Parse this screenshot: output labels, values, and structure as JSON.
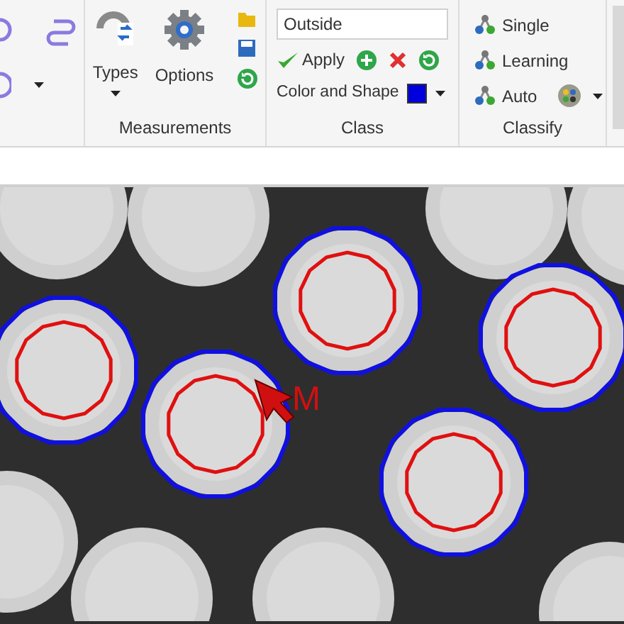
{
  "ribbon": {
    "measurements": {
      "label": "Measurements",
      "buttons": [
        {
          "label": "Types"
        },
        {
          "label": "Options"
        }
      ]
    },
    "class": {
      "label": "Class",
      "dropdown": {
        "value": "Outside"
      },
      "apply": "Apply",
      "color_shape": {
        "label": "Color and Shape",
        "color": "#0000dd"
      }
    },
    "classify": {
      "label": "Classify",
      "items": [
        {
          "label": "Single"
        },
        {
          "label": "Learning"
        },
        {
          "label": "Auto"
        }
      ]
    }
  },
  "image_view": {
    "cursor_label": "M"
  }
}
